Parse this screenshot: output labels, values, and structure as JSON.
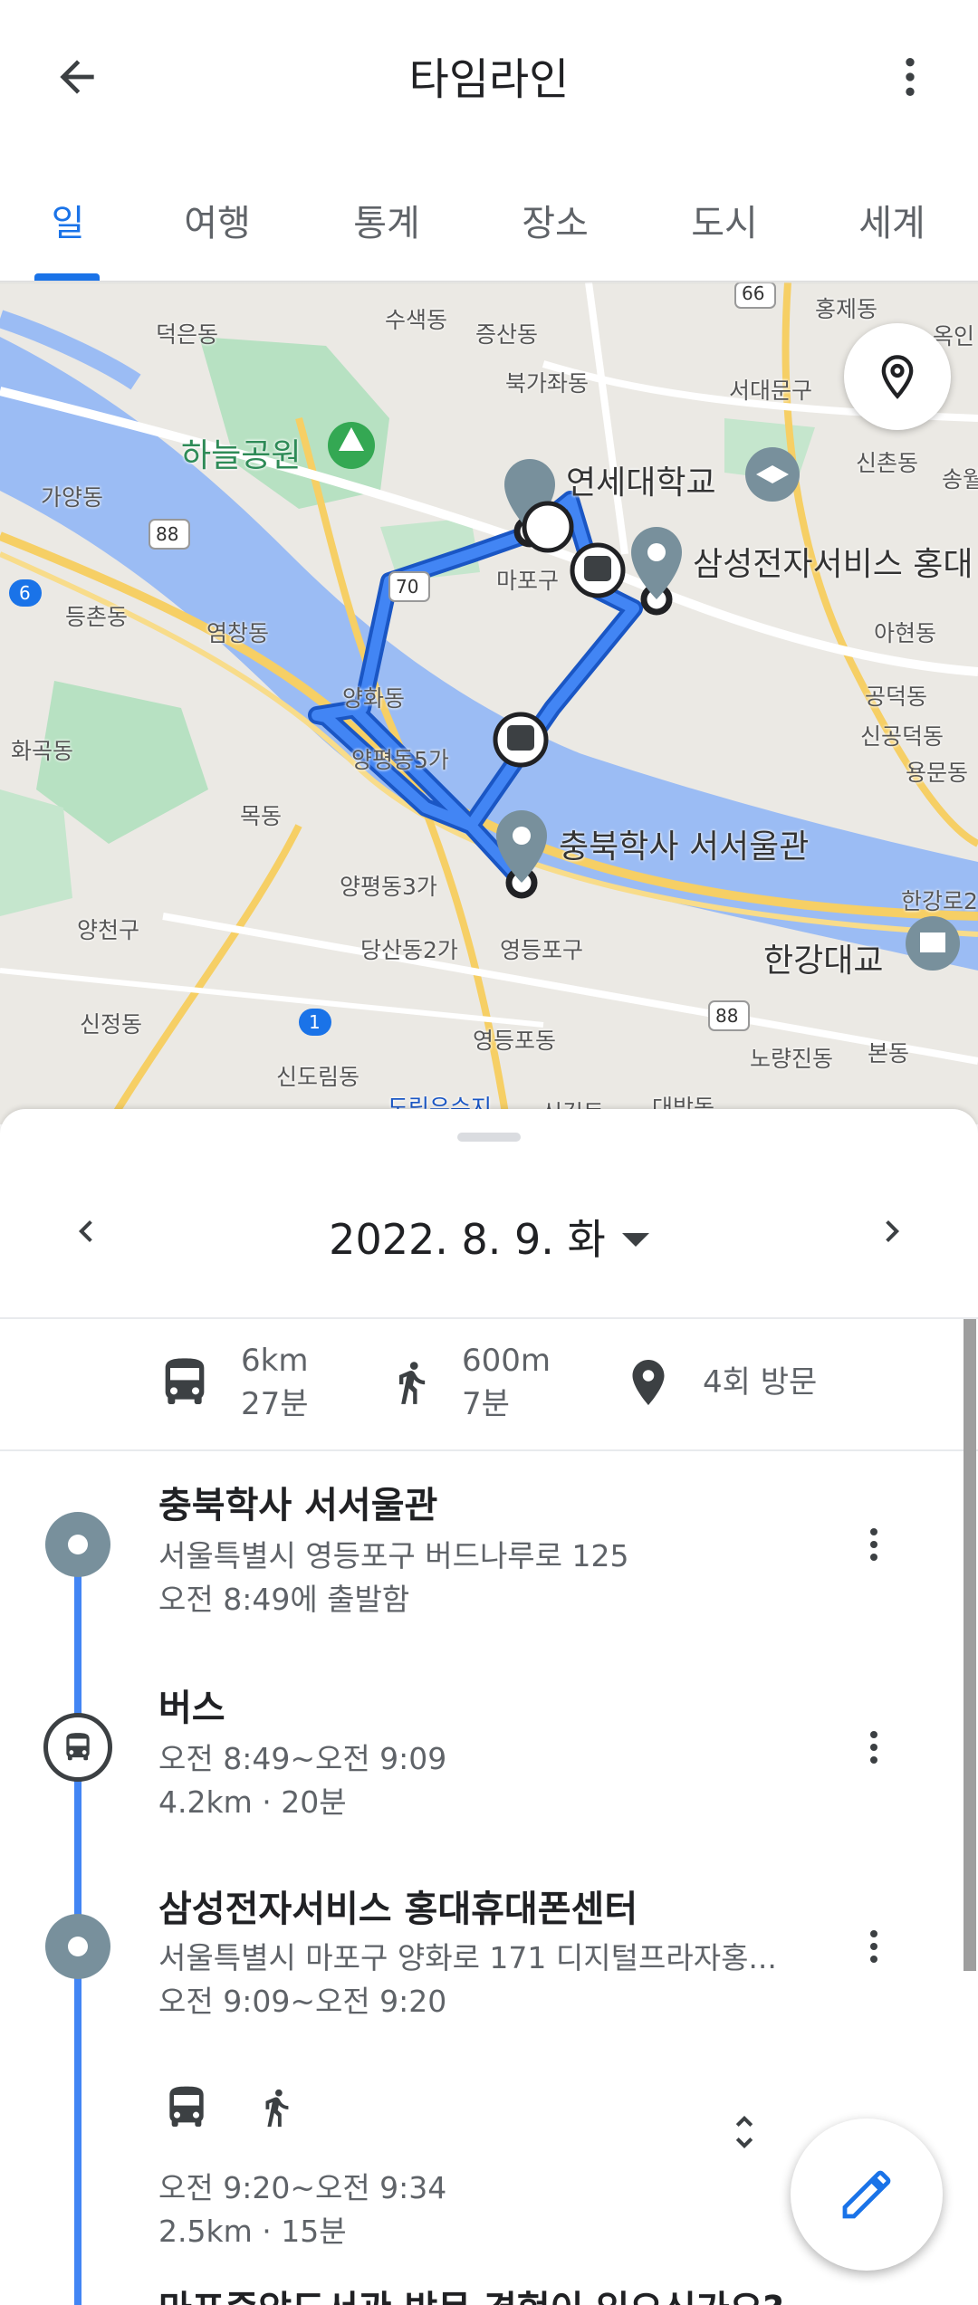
{
  "header": {
    "title": "타임라인"
  },
  "tabs": [
    {
      "label": "일",
      "active": true
    },
    {
      "label": "여행",
      "active": false
    },
    {
      "label": "통계",
      "active": false
    },
    {
      "label": "장소",
      "active": false
    },
    {
      "label": "도시",
      "active": false
    },
    {
      "label": "세계",
      "active": false
    }
  ],
  "map": {
    "labels": {
      "deokeun": "덕은동",
      "susaek": "수색동",
      "jeungsan": "증산동",
      "hongje": "홍제동",
      "okin": "옥인",
      "bukgajwa": "북가좌동",
      "seodaemun": "서대문구",
      "haneul_park": "하늘공원",
      "yonsei": "연세대학교",
      "sinchon": "신촌동",
      "songwol": "송월",
      "gayang": "가양동",
      "mapo": "마포구",
      "samsung_service": "삼성전자서비스 홍대",
      "deungchon": "등촌동",
      "yeomchang": "염창동",
      "ahyeon": "아현동",
      "yanghwa": "양화동",
      "gongdeok": "공덕동",
      "singongdeok": "신공덕동",
      "hwagok": "화곡동",
      "yangpyeong5": "양평동5가",
      "yongmun": "용문동",
      "mok": "목동",
      "chungbuk_dorm": "충북학사 서서울관",
      "yangpyeong3": "양평동3가",
      "hangang2": "한강로2",
      "yangcheon": "양천구",
      "dangsan2": "당산동2가",
      "yeongdeungpo_gu": "영등포구",
      "hangang_bridge": "한강대교",
      "sinjeong": "신정동",
      "yeongdeungpo_dong": "영등포동",
      "noryangjin": "노량진동",
      "bon": "본동",
      "sindorim": "신도림동",
      "dorimcheon": "도림유수지",
      "singil": "신길동",
      "daebang": "대방동"
    },
    "route_badges": [
      "88",
      "70",
      "66",
      "6",
      "1",
      "88"
    ]
  },
  "date_nav": {
    "date": "2022. 8. 9. 화"
  },
  "summary": {
    "bus_distance": "6km",
    "bus_time": "27분",
    "walk_distance": "600m",
    "walk_time": "7분",
    "visits": "4회 방문"
  },
  "timeline": [
    {
      "type": "place",
      "title": "충북학사 서서울관",
      "line1": "서울특별시 영등포구 버드나루로 125",
      "line2": "오전 8:49에 출발함"
    },
    {
      "type": "bus",
      "title": "버스",
      "line1": "오전 8:49~오전 9:09",
      "line2": "4.2km · 20분"
    },
    {
      "type": "place",
      "title": "삼성전자서비스 홍대휴대폰센터",
      "line1": "서울특별시 마포구 양화로 171 디지털프라자홍...",
      "line2": "오전 9:09~오전 9:20"
    },
    {
      "type": "multi",
      "title": "",
      "line1": "오전 9:20~오전 9:34",
      "line2": "2.5km · 15분"
    }
  ],
  "footer_question": "마포중앙도서관 방문 경험이 있으신가요?",
  "icons": {
    "back": "arrow-back-icon",
    "more": "more-vert-icon",
    "location": "location-pin-icon",
    "edit": "pencil-icon"
  },
  "colors": {
    "accent": "#1a73e8",
    "route": "#4285f4",
    "water": "#9bbcf4",
    "park": "#a8dab5"
  }
}
